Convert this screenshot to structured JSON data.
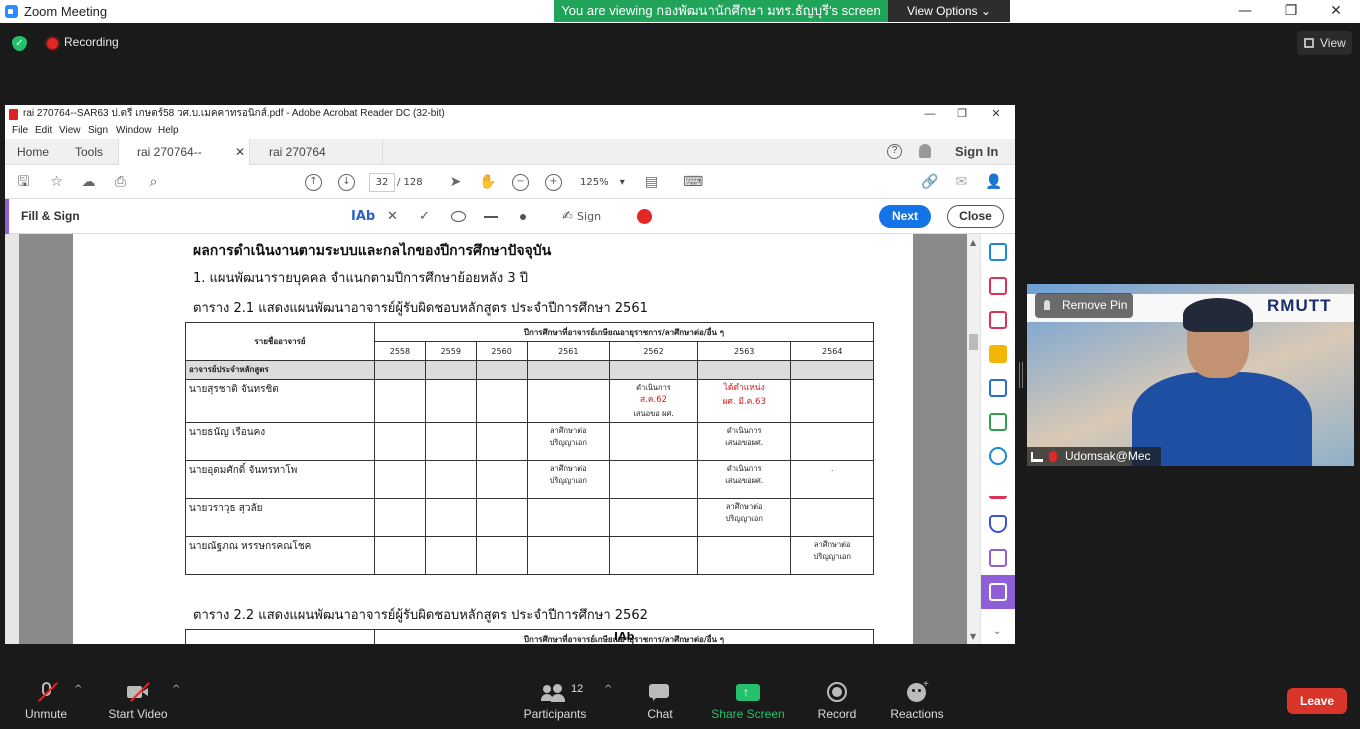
{
  "zoom": {
    "window_title": "Zoom Meeting",
    "share_banner": "You are viewing กองพัฒนานักศึกษา มทร.ธัญบุรี's screen",
    "view_options": "View Options",
    "recording_label": "Recording",
    "view_button": "View",
    "colors": {
      "banner_green": "#1fa45a",
      "leave_red": "#d9352b",
      "share_green": "#23c16b"
    }
  },
  "acrobat": {
    "window_title": "rai 270764--SAR63 ป.ตรี เกษตร์58 วศ.บ.เมคคาทรอนิกส์.pdf - Adobe Acrobat Reader DC (32-bit)",
    "menu": [
      "File",
      "Edit",
      "View",
      "Sign",
      "Window",
      "Help"
    ],
    "tabs": {
      "home": "Home",
      "tools": "Tools",
      "doc1": "rai 270764--SAR63...",
      "doc2": "rai 270764 SAR63ห..."
    },
    "sign_in": "Sign In",
    "page_current": "32",
    "page_total": "/ 128",
    "zoom_level": "125%",
    "fill_sign": {
      "title": "Fill & Sign",
      "text_tool": "IAb",
      "cross": "✕",
      "check": "✓",
      "sign": "Sign",
      "next": "Next",
      "close": "Close"
    }
  },
  "document": {
    "heading_main": "ผลการดำเนินงานตามระบบและกลไกของปีการศึกษาปัจจุบัน",
    "heading_sub": "1.  แผนพัฒนารายบุคคล จำแนกตามปีการศึกษาย้อยหลัง 3 ปี",
    "table1_title": "ตาราง 2.1 แสดงแผนพัฒนาอาจารย์ผู้รับผิดชอบหลักสูตร ประจำปีการศึกษา 2561",
    "table2_title": "ตาราง 2.2 แสดงแผนพัฒนาอาจารย์ผู้รับผิดชอบหลักสูตร ประจำปีการศึกษา 2562",
    "table": {
      "name_header": "รายชื่ออาจารย์",
      "years_header": "ปีการศึกษาที่อาจารย์เกษียณอายุราชการ/ลาศึกษาต่อ/อื่น ๆ",
      "years": [
        "2558",
        "2559",
        "2560",
        "2561",
        "2562",
        "2563",
        "2564"
      ],
      "group_row": "อาจารย์ประจำหลักสูตร",
      "rows": [
        {
          "name": "นายสุรชาติ จันทรชิต",
          "cells": [
            "",
            "",
            "",
            "",
            "ดำเนินการ|ส.ค.62|เสนอขอ ผศ.",
            "ได้ตำแหน่ง|ผศ. มี.ค.63",
            ""
          ]
        },
        {
          "name": "นายธนัญ เรือนคง",
          "cells": [
            "",
            "",
            "",
            "ลาศึกษาต่อ|ปริญญาเอก",
            "",
            "ดำเนินการ|เสนอขอผศ.",
            ""
          ]
        },
        {
          "name": "นายอุดมศักดิ์ จันทรทาโพ",
          "cells": [
            "",
            "",
            "",
            "ลาศึกษาต่อ|ปริญญาเอก",
            "",
            "ดำเนินการ|เสนอขอผศ.",
            "."
          ]
        },
        {
          "name": "นายวราวุธ สุวลัย",
          "cells": [
            "",
            "",
            "",
            "",
            "",
            "ลาศึกษาต่อ|ปริญญาเอก",
            ""
          ]
        },
        {
          "name": "นายณัฐภณ หรรษกรคณโชค",
          "cells": [
            "",
            "",
            "",
            "",
            "",
            "",
            "ลาศึกษาต่อ|ปริญญาเอก"
          ]
        }
      ],
      "table2_years_header": "ปีการศึกษาที่อาจารย์เกษียณอายุราชการ/ลาศึกษาต่อ/อื่น ๆ",
      "cursor_label": "IAb"
    }
  },
  "video": {
    "remove_pin": "Remove Pin",
    "participant_name": "Udomsak@Mec",
    "logo_text": "RMUTT"
  },
  "toolbar": {
    "unmute": "Unmute",
    "start_video": "Start Video",
    "participants": "Participants",
    "participants_count": "12",
    "chat": "Chat",
    "share_screen": "Share Screen",
    "record": "Record",
    "reactions": "Reactions",
    "leave": "Leave"
  }
}
